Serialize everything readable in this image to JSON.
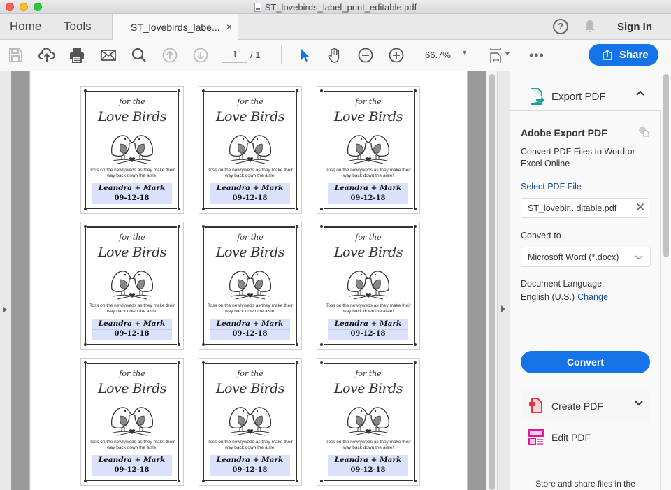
{
  "window": {
    "title": "ST_lovebirds_label_print_editable.pdf"
  },
  "tabbar": {
    "home_label": "Home",
    "tools_label": "Tools",
    "document_tab_label": "ST_lovebirds_labe...",
    "close_glyph": "×",
    "help_glyph": "?",
    "sign_in_label": "Sign In"
  },
  "toolbar": {
    "icons": [
      "save-icon",
      "upload-cloud-icon",
      "print-icon",
      "email-icon",
      "search-icon",
      "page-up-icon",
      "page-down-icon",
      "select-pointer-icon",
      "hand-icon",
      "zoom-out-icon",
      "zoom-in-icon",
      "page-fit-icon",
      "more-icon"
    ],
    "current_page": "1",
    "total_pages": "/ 1",
    "zoom_level": "66.7%",
    "zoom_caret": "▾",
    "more_glyph": "•••",
    "share_label": "Share",
    "accent_color": "#1473e6"
  },
  "document": {
    "labels": [
      {
        "for_the": "for the",
        "title": "Love Birds",
        "message": "Toss on the newlyweds as they make their way back down the aisle!",
        "names": "Leandra + Mark",
        "date": "09-12-18"
      },
      {
        "for_the": "for the",
        "title": "Love Birds",
        "message": "Toss on the newlyweds as they make their way back down the aisle!",
        "names": "Leandra + Mark",
        "date": "09-12-18"
      },
      {
        "for_the": "for the",
        "title": "Love Birds",
        "message": "Toss on the newlyweds as they make their way back down the aisle!",
        "names": "Leandra + Mark",
        "date": "09-12-18"
      },
      {
        "for_the": "for the",
        "title": "Love Birds",
        "message": "Toss on the newlyweds as they make their way back down the aisle!",
        "names": "Leandra + Mark",
        "date": "09-12-18"
      },
      {
        "for_the": "for the",
        "title": "Love Birds",
        "message": "Toss on the newlyweds as they make their way back down the aisle!",
        "names": "Leandra + Mark",
        "date": "09-12-18"
      },
      {
        "for_the": "for the",
        "title": "Love Birds",
        "message": "Toss on the newlyweds as they make their way back down the aisle!",
        "names": "Leandra + Mark",
        "date": "09-12-18"
      },
      {
        "for_the": "for the",
        "title": "Love Birds",
        "message": "Toss on the newlyweds as they make their way back down the aisle!",
        "names": "Leandra + Mark",
        "date": "09-12-18"
      },
      {
        "for_the": "for the",
        "title": "Love Birds",
        "message": "Toss on the newlyweds as they make their way back down the aisle!",
        "names": "Leandra + Mark",
        "date": "09-12-18"
      },
      {
        "for_the": "for the",
        "title": "Love Birds",
        "message": "Toss on the newlyweds as they make their way back down the aisle!",
        "names": "Leandra + Mark",
        "date": "09-12-18"
      }
    ],
    "name_band_color": "#d9e1fb"
  },
  "right_panel": {
    "export_section": {
      "title": "Export PDF",
      "collapse_glyph": "⌃",
      "heading": "Adobe Export PDF",
      "description": "Convert PDF Files to Word or Excel Online",
      "select_file_label": "Select PDF File",
      "selected_file": "ST_lovebir...ditable.pdf",
      "clear_glyph": "✕",
      "convert_to_label": "Convert to",
      "convert_to_value": "Microsoft Word (*.docx)",
      "select_caret": "⌄",
      "language_label": "Document Language:",
      "language_value": "English (U.S.)",
      "change_link": "Change",
      "convert_button": "Convert",
      "icon_color": "#1aa39a"
    },
    "tools": [
      {
        "label": "Create PDF",
        "icon": "create-pdf-icon",
        "color": "#e8323c",
        "expand_glyph": "⌄"
      },
      {
        "label": "Edit PDF",
        "icon": "edit-pdf-icon",
        "color": "#e1179b"
      }
    ],
    "footer_text": "Store and share files in the"
  }
}
